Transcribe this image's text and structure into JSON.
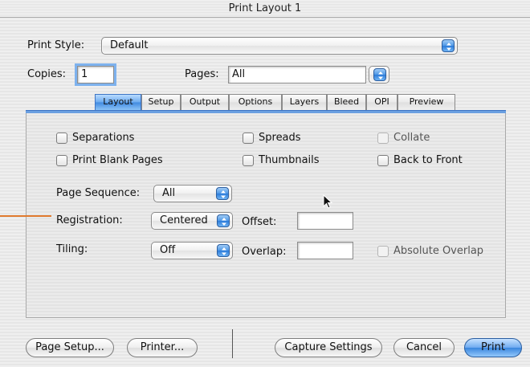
{
  "window": {
    "title": "Print Layout 1"
  },
  "print_style": {
    "label": "Print Style:",
    "value": "Default"
  },
  "copies": {
    "label": "Copies:",
    "value": "1"
  },
  "pages": {
    "label": "Pages:",
    "value": "All"
  },
  "tabs": [
    "Layout",
    "Setup",
    "Output",
    "Options",
    "Layers",
    "Bleed",
    "OPI",
    "Preview"
  ],
  "active_tab": "Layout",
  "checkboxes": {
    "separations": "Separations",
    "spreads": "Spreads",
    "collate": "Collate",
    "print_blank_pages": "Print Blank Pages",
    "thumbnails": "Thumbnails",
    "back_to_front": "Back to Front",
    "absolute_overlap": "Absolute Overlap"
  },
  "page_sequence": {
    "label": "Page Sequence:",
    "value": "All"
  },
  "registration": {
    "label": "Registration:",
    "value": "Centered",
    "offset_label": "Offset:",
    "offset_value": ""
  },
  "tiling": {
    "label": "Tiling:",
    "value": "Off",
    "overlap_label": "Overlap:",
    "overlap_value": ""
  },
  "buttons": {
    "page_setup": "Page Setup...",
    "printer": "Printer...",
    "capture_settings": "Capture Settings",
    "cancel": "Cancel",
    "print": "Print"
  },
  "colors": {
    "accent": "#3f89e0",
    "annotation": "#e07a2e"
  }
}
